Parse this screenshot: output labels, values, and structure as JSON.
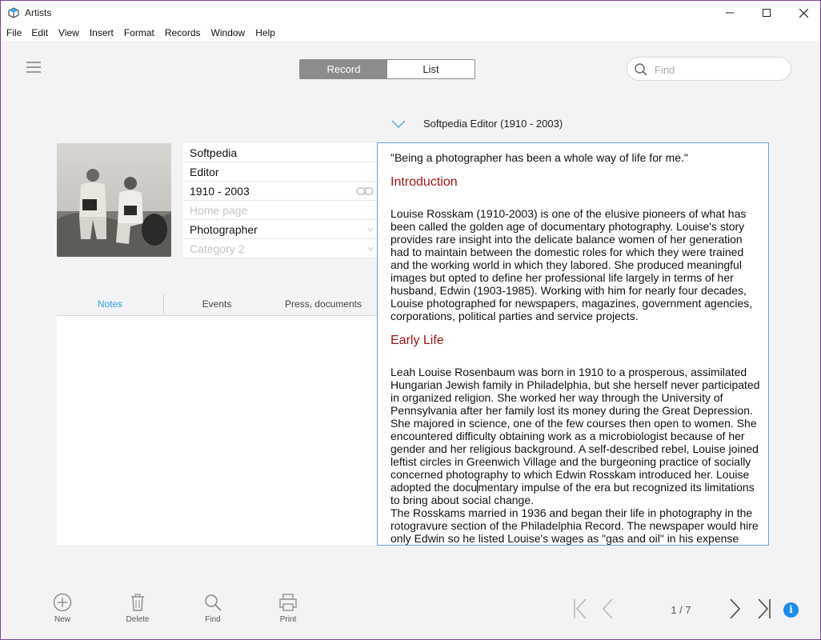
{
  "window": {
    "title": "Artists"
  },
  "menu": [
    "File",
    "Edit",
    "View",
    "Insert",
    "Format",
    "Records",
    "Window",
    "Help"
  ],
  "view_toggle": {
    "record": "Record",
    "list": "List",
    "active": "record"
  },
  "search": {
    "placeholder": "Find"
  },
  "record": {
    "heading": "Softpedia Editor (1910 - 2003)",
    "fields": [
      {
        "value": "Softpedia",
        "placeholder": false
      },
      {
        "value": "Editor",
        "placeholder": false
      },
      {
        "value": "1910 - 2003",
        "placeholder": false,
        "icon": "link-icon"
      },
      {
        "value": "Home page",
        "placeholder": true
      },
      {
        "value": "Photographer",
        "placeholder": false,
        "icon": "dropdown-icon"
      },
      {
        "value": "Category 2",
        "placeholder": true,
        "icon": "dropdown-icon"
      }
    ]
  },
  "tabs": [
    {
      "label": "Notes",
      "active": true
    },
    {
      "label": "Events",
      "active": false
    },
    {
      "label": "Press, documents",
      "active": false
    }
  ],
  "document": {
    "quote": "\"Being a photographer has been a whole way of life for me.\"",
    "intro_heading": "Introduction",
    "intro_text": "Louise Rosskam (1910-2003) is one of the elusive pioneers of what has been called the golden age of documentary photography. Louise's story provides rare insight into the delicate balance women of her generation had to maintain between the domestic roles for which they were trained and the working world in which they labored. She produced meaningful images but opted to define her professional life largely in terms of her husband, Edwin (1903-1985). Working with him for nearly four decades, Louise photographed for newspapers, magazines, government agencies, corporations, political parties and service projects.",
    "early_heading": "Early Life",
    "early_text_a": "Leah Louise Rosenbaum was born in 1910 to a prosperous, assimilated Hungarian Jewish family in Philadelphia, but she herself never participated in organized religion. She worked her way through the University of Pennsylvania after her family lost its money during the Great Depression. She majored in science, one of the few courses then open to women. She encountered difficulty obtaining work as a microbiologist because of her gender and her religious background. A self-described rebel, Louise joined leftist circles in Greenwich Village and the burgeoning practice of socially concerned photography to which Edwin Rosskam introduced her. Louise adopted the docu",
    "early_text_b": "mentary impulse of the era but recognized its limitations to bring about social change.",
    "early_text_c": "The Rosskams married in 1936 and began their life in photography in the rotogravure section of the Philadelphia Record. The newspaper would hire only Edwin so he listed Louise's wages as \"gas and oil\" in his expense account."
  },
  "bottom": {
    "new": "New",
    "delete": "Delete",
    "find": "Find",
    "print": "Print",
    "pager": "1 / 7"
  },
  "colors": {
    "accent": "#1b8de8",
    "section_heading": "#a31515",
    "active_tab": "#2f9be0"
  }
}
